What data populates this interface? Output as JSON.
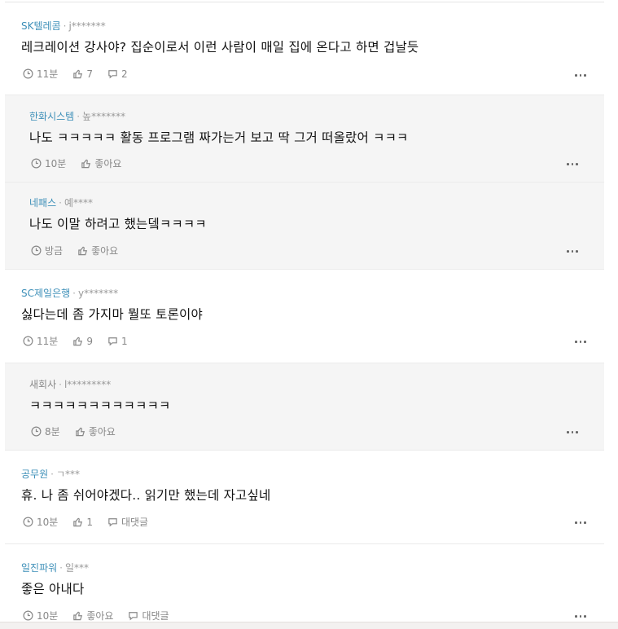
{
  "comments": [
    {
      "company": "SK텔레콤",
      "user": "j*******",
      "text": "레크레이션 강사야? 집순이로서 이런 사람이 매일 집에 온다고 하면 겁날듯",
      "time": "11분",
      "likes": "7",
      "replies": "2",
      "is_reply": false
    },
    {
      "company": "한화시스템",
      "user": "높*******",
      "text": "나도 ㅋㅋㅋㅋㅋ 활동 프로그램 짜가는거 보고 딱 그거 떠올랐어 ㅋㅋㅋ",
      "time": "10분",
      "likes": "좋아요",
      "replies": "",
      "is_reply": true
    },
    {
      "company": "네패스",
      "user": "예****",
      "text": "나도 이말 하려고 했는뎈ㅋㅋㅋㅋ",
      "time": "방금",
      "likes": "좋아요",
      "replies": "",
      "is_reply": true
    },
    {
      "company": "SC제일은행",
      "user": "y*******",
      "text": "싫다는데 좀 가지마 뭘또 토론이야",
      "time": "11분",
      "likes": "9",
      "replies": "1",
      "is_reply": false
    },
    {
      "company": "새회사",
      "user": "l*********",
      "text": "ㅋㅋㅋㅋㅋㅋㅋㅋㅋㅋㅋㅋ",
      "time": "8분",
      "likes": "좋아요",
      "replies": "",
      "is_reply": true
    },
    {
      "company": "공무원",
      "user": "ㄱ***",
      "text": "휴. 나 좀 쉬어야겠다.. 읽기만 했는데 자고싶네",
      "time": "10분",
      "likes": "1",
      "replies": "대댓글",
      "is_reply": false
    },
    {
      "company": "일진파워",
      "user": "일***",
      "text": "좋은 아내다",
      "time": "10분",
      "likes": "좋아요",
      "replies": "대댓글",
      "is_reply": false
    }
  ],
  "separator": "·",
  "icons": {
    "time": "clock-icon",
    "like": "thumbs-up-icon",
    "reply": "speech-bubble-icon",
    "more": "more-dots-icon"
  },
  "colors": {
    "company": "#3d8fb8",
    "reply_bg": "#f5f5f5"
  }
}
